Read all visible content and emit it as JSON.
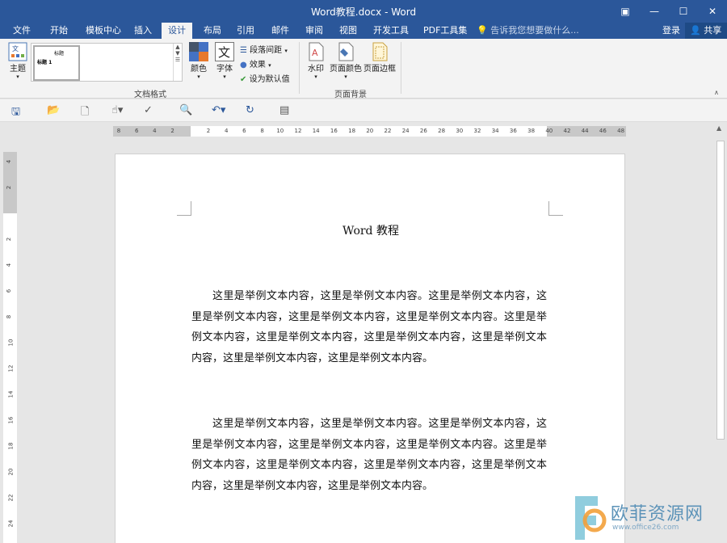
{
  "window": {
    "title": "Word教程.docx - Word",
    "controls": [
      "ribbon-display-icon",
      "minimize-icon",
      "maximize-icon",
      "close-icon"
    ]
  },
  "ribbon": {
    "tabs": [
      {
        "label": "文件"
      },
      {
        "label": "开始"
      },
      {
        "label": "模板中心"
      },
      {
        "label": "插入"
      },
      {
        "label": "设计",
        "active": true
      },
      {
        "label": "布局"
      },
      {
        "label": "引用"
      },
      {
        "label": "邮件"
      },
      {
        "label": "审阅"
      },
      {
        "label": "视图"
      },
      {
        "label": "开发工具"
      },
      {
        "label": "PDF工具集"
      }
    ],
    "tell_me": "告诉我您想要做什么...",
    "login": "登录",
    "share": "共享",
    "theme_label": "主题",
    "gallery_thumb_title": "标题",
    "gallery_thumb_heading": "标题 1",
    "colors_label": "颜色",
    "fonts_label": "字体",
    "paragraph_spacing": "段落间距",
    "effects": "效果",
    "set_default": "设为默认值",
    "doc_format_group": "文档格式",
    "watermark": "水印",
    "page_color": "页面颜色",
    "page_borders": "页面边框",
    "page_background_group": "页面背景",
    "accent_colors": {
      "title_bar": "#2b579a",
      "colors_a": "#e8792c",
      "colors_b": "#4472c4",
      "colors_c": "#44546a"
    }
  },
  "ruler": {
    "horizontal_ticks": [
      "8",
      "6",
      "4",
      "2",
      "",
      "2",
      "4",
      "6",
      "8",
      "10",
      "12",
      "14",
      "16",
      "18",
      "20",
      "22",
      "24",
      "26",
      "28",
      "30",
      "32",
      "34",
      "36",
      "38",
      "40",
      "42",
      "44",
      "46",
      "48"
    ],
    "vertical_ticks": [
      "4",
      "2",
      "",
      "2",
      "4",
      "6",
      "8",
      "10",
      "12",
      "14",
      "16",
      "18",
      "20",
      "22",
      "24"
    ]
  },
  "document": {
    "title": "Word 教程",
    "paragraphs": [
      "这里是举例文本内容，这里是举例文本内容。这里是举例文本内容，这里是举例文本内容，这里是举例文本内容，这里是举例文本内容。这里是举例文本内容，这里是举例文本内容，这里是举例文本内容，这里是举例文本内容，这里是举例文本内容，这里是举例文本内容。",
      "这里是举例文本内容，这里是举例文本内容。这里是举例文本内容，这里是举例文本内容，这里是举例文本内容，这里是举例文本内容。这里是举例文本内容，这里是举例文本内容，这里是举例文本内容，这里是举例文本内容，这里是举例文本内容，这里是举例文本内容。"
    ]
  },
  "watermark_overlay": {
    "cn": "欧菲资源网",
    "en": "www.office26.com"
  }
}
